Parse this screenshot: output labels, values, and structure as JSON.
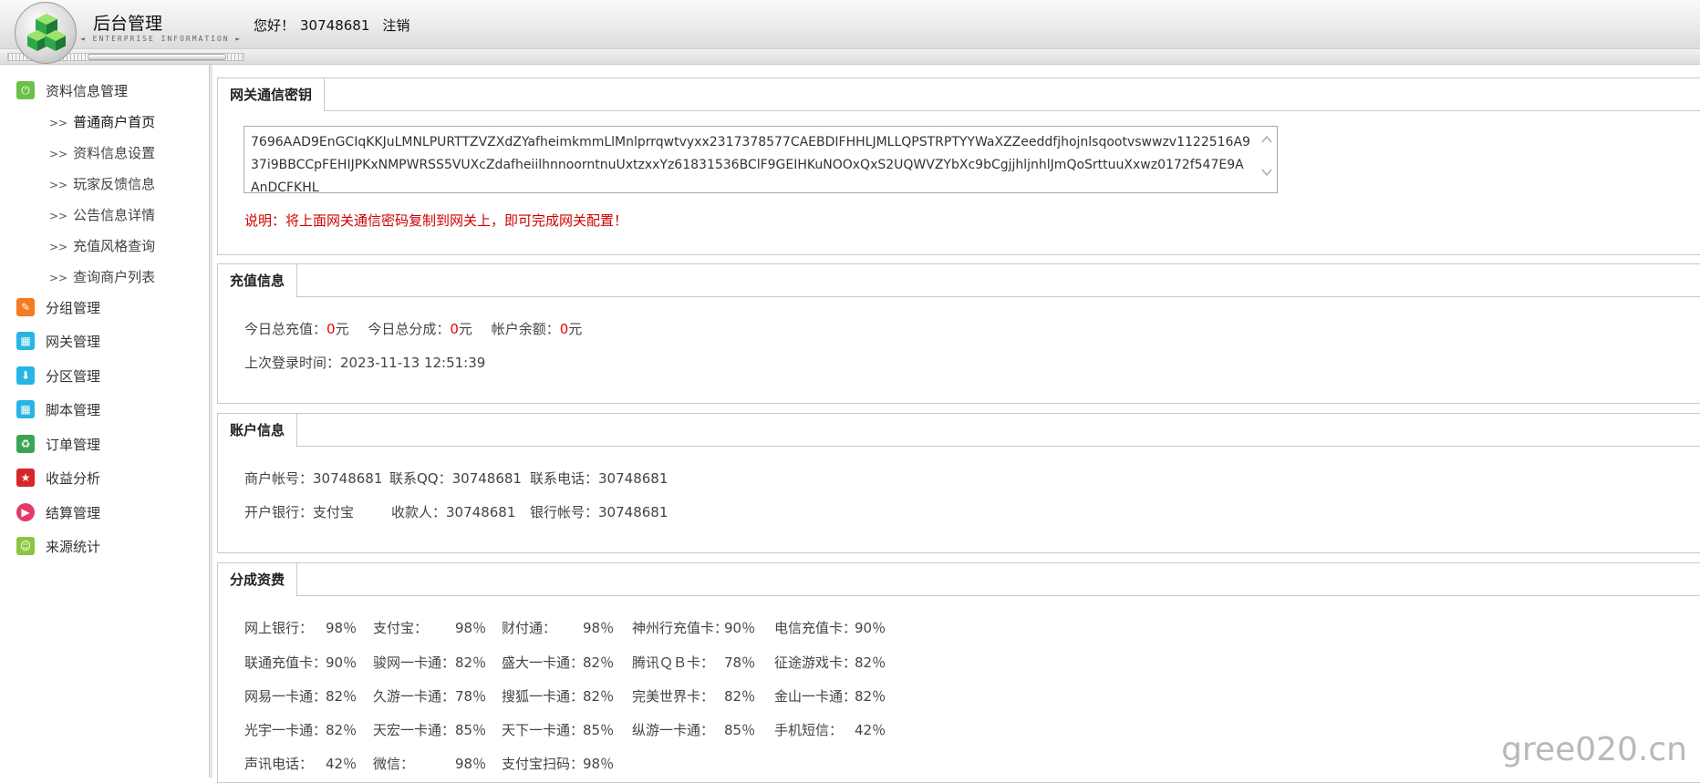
{
  "header": {
    "title": "后台管理",
    "subtitle": "◄ ENTERPRISE INFORMATION ►",
    "greeting": "您好！",
    "user_id": "30748681",
    "logout": "注销"
  },
  "sidebar": {
    "groups": [
      {
        "label": "资料信息管理",
        "icon": "power-icon",
        "color": "#6cc04a"
      },
      {
        "label": "分组管理",
        "icon": "pencil-icon",
        "color": "#f47b20"
      },
      {
        "label": "网关管理",
        "icon": "grid-icon",
        "color": "#27b5e6"
      },
      {
        "label": "分区管理",
        "icon": "download-icon",
        "color": "#27b5e6"
      },
      {
        "label": "脚本管理",
        "icon": "grid-icon",
        "color": "#27b5e6"
      },
      {
        "label": "订单管理",
        "icon": "recycle-icon",
        "color": "#3aa655"
      },
      {
        "label": "收益分析",
        "icon": "star-icon",
        "color": "#d7262b"
      },
      {
        "label": "结算管理",
        "icon": "play-icon",
        "color": "#e23a6b"
      },
      {
        "label": "来源统计",
        "icon": "smile-icon",
        "color": "#8cc63f"
      }
    ],
    "sub_items": [
      {
        "arrow": ">>",
        "label": "普通商户首页"
      },
      {
        "arrow": ">>",
        "label": "资料信息设置"
      },
      {
        "arrow": ">>",
        "label": "玩家反馈信息"
      },
      {
        "arrow": ">>",
        "label": "公告信息详情"
      },
      {
        "arrow": ">>",
        "label": "充值风格查询"
      },
      {
        "arrow": ">>",
        "label": "查询商户列表"
      }
    ]
  },
  "gateway_key": {
    "tab": "网关通信密钥",
    "key": "7696AAD9EnGCIqKKJuLMNLPURTTZVZXdZYafheimkmmLlMnlprrqwtvyxx2317378577CAEBDIFHHLJMLLQPSTRPTYYWaXZZeeddfjhojnlsqootvswwzv1122516A937i9BBCCpFEHIJPKxNMPWRSS5VUXcZdafheiilhnnoorntnuUxtzxxYz61831536BClF9GEIHKuNOOxQxS2UQWVZYbXc9bCgjjhljnhlJmQoSrttuuXxwz0172f547E9AAnDCFKHL",
    "note": "说明：将上面网关通信密码复制到网关上，即可完成网关配置！"
  },
  "recharge": {
    "tab": "充值信息",
    "today_recharge_label": "今日总充值：",
    "today_recharge_value": "0",
    "today_share_label": "今日总分成：",
    "today_share_value": "0",
    "balance_label": "帐户余额：",
    "balance_value": "0",
    "unit": "元",
    "last_login_label": "上次登录时间：",
    "last_login": "2023-11-13 12:51:39"
  },
  "account": {
    "tab": "账户信息",
    "merchant_label": "商户帐号：",
    "merchant": "30748681",
    "qq_label": "联系QQ：",
    "qq": "30748681",
    "phone_label": "联系电话：",
    "phone": "30748681",
    "bank_label": "开户银行：",
    "bank": "支付宝",
    "payee_label": "收款人：",
    "payee": "30748681",
    "bank_account_label": "银行帐号：",
    "bank_account": "30748681"
  },
  "fees": {
    "tab": "分成资费",
    "rows": [
      [
        {
          "label": "网上银行：",
          "value": "98％"
        },
        {
          "label": "支付宝：",
          "value": "98％"
        },
        {
          "label": "财付通：",
          "value": "98％"
        },
        {
          "label": "神州行充值卡：",
          "value": "90％"
        },
        {
          "label": "电信充值卡：",
          "value": "90％"
        }
      ],
      [
        {
          "label": "联通充值卡：",
          "value": "90％"
        },
        {
          "label": "骏网一卡通：",
          "value": "82％"
        },
        {
          "label": "盛大一卡通：",
          "value": "82％"
        },
        {
          "label": "腾讯ＱＢ卡：",
          "value": "78％"
        },
        {
          "label": "征途游戏卡：",
          "value": "82％"
        }
      ],
      [
        {
          "label": "网易一卡通：",
          "value": "82％"
        },
        {
          "label": "久游一卡通：",
          "value": "78％"
        },
        {
          "label": "搜狐一卡通：",
          "value": "82％"
        },
        {
          "label": "完美世界卡：",
          "value": "82％"
        },
        {
          "label": "金山一卡通：",
          "value": "82％"
        }
      ],
      [
        {
          "label": "光宇一卡通：",
          "value": "82％"
        },
        {
          "label": "天宏一卡通：",
          "value": "85％"
        },
        {
          "label": "天下一卡通：",
          "value": "85％"
        },
        {
          "label": "纵游一卡通：",
          "value": "85％"
        },
        {
          "label": "手机短信：",
          "value": "42％"
        }
      ],
      [
        {
          "label": "声讯电话：",
          "value": "42％"
        },
        {
          "label": "微信：",
          "value": "98％"
        },
        {
          "label": "支付宝扫码：",
          "value": "98％"
        }
      ]
    ]
  },
  "watermark": "gree020.cn"
}
